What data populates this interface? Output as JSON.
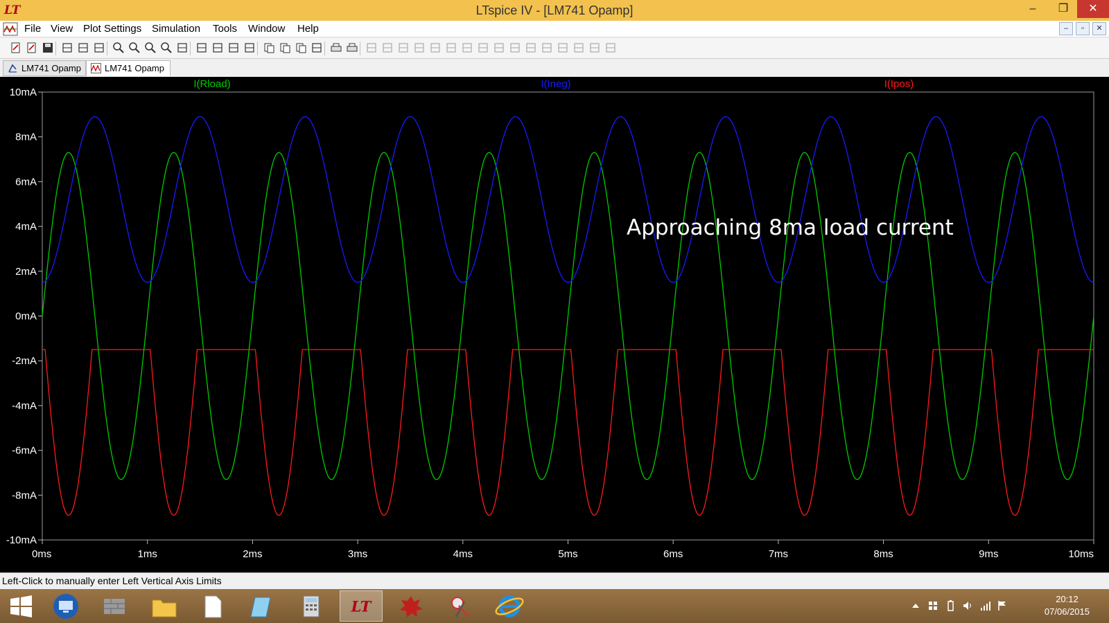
{
  "window": {
    "title": "LTspice IV - [LM741 Opamp]",
    "logo": "ltspice-logo-icon",
    "controls": {
      "minimize": "–",
      "maximize": "❐",
      "close": "✕"
    }
  },
  "menu": {
    "items": [
      "File",
      "View",
      "Plot Settings",
      "Simulation",
      "Tools",
      "Window",
      "Help"
    ],
    "mdi": {
      "minimize": "–",
      "restore": "▫",
      "close": "✕"
    }
  },
  "toolbar": {
    "icons": [
      "new-schematic-icon",
      "open-icon",
      "save-icon",
      "control-panel-icon",
      "run-icon",
      "pan-icon",
      "zoom-in-icon",
      "zoom-out-icon",
      "zoom-fit-icon",
      "zoom-cancel-icon",
      "autoscale-icon",
      "grid-icon",
      "tile-horizontal-icon",
      "cascade-icon",
      "tile-vertical-icon",
      "cut-icon",
      "copy-icon",
      "paste-icon",
      "find-icon",
      "print-preview-icon",
      "print-icon",
      "wire-icon",
      "ground-icon",
      "label-icon",
      "resistor-icon",
      "capacitor-icon",
      "inductor-icon",
      "diode-icon",
      "component-icon",
      "move-icon",
      "drag-icon",
      "undo-icon",
      "redo-icon",
      "rotate-icon",
      "mirror-icon",
      "text-icon",
      "spice-directive-icon"
    ]
  },
  "tabs": [
    {
      "label": "LM741 Opamp",
      "icon": "schematic-icon",
      "active": false
    },
    {
      "label": "LM741 Opamp",
      "icon": "waveform-icon",
      "active": true
    }
  ],
  "chart_data": {
    "type": "line",
    "title": "",
    "xlabel": "",
    "ylabel": "",
    "xlim": [
      0,
      10
    ],
    "ylim": [
      -10,
      10
    ],
    "x_unit": "ms",
    "y_unit": "mA",
    "x_ticks": [
      "0ms",
      "1ms",
      "2ms",
      "3ms",
      "4ms",
      "5ms",
      "6ms",
      "7ms",
      "8ms",
      "9ms",
      "10ms"
    ],
    "y_ticks": [
      "10mA",
      "8mA",
      "6mA",
      "4mA",
      "2mA",
      "0mA",
      "-2mA",
      "-4mA",
      "-6mA",
      "-8mA",
      "-10mA"
    ],
    "background": "#000000",
    "grid": false,
    "legend": "top",
    "annotation": "Approaching 8ma load current",
    "frequency_khz": 1,
    "series": [
      {
        "name": "I(Rload)",
        "color": "#00cc00",
        "kind": "sine",
        "amplitude": 7.3,
        "offset": 0,
        "phase_deg": 0
      },
      {
        "name": "I(Ineg)",
        "color": "#1a1aff",
        "kind": "shifted-sine",
        "amplitude": 3.7,
        "offset": 5.2,
        "phase_deg": -90
      },
      {
        "name": "I(Ipos)",
        "color": "#ff1a1a",
        "kind": "clipped-sine",
        "amplitude": 8.9,
        "offset": 0,
        "phase_deg": 180,
        "clip_max": -1.5
      }
    ]
  },
  "status": {
    "text": "Left-Click to manually enter Left Vertical Axis Limits"
  },
  "taskbar": {
    "apps": [
      "start-icon",
      "remote-desktop-icon",
      "file-explorer-wall-icon",
      "folder-icon",
      "document-icon",
      "notepad-icon",
      "calculator-icon",
      "ltspice-task-icon",
      "app-splat-icon",
      "snipping-tool-icon",
      "internet-explorer-icon"
    ],
    "tray": [
      "tray-up-arrow-icon",
      "tray-windows-icon",
      "tray-battery-icon",
      "tray-volume-icon",
      "tray-signal-icon",
      "tray-flag-icon"
    ],
    "time": "20:12",
    "date": "07/06/2015"
  }
}
